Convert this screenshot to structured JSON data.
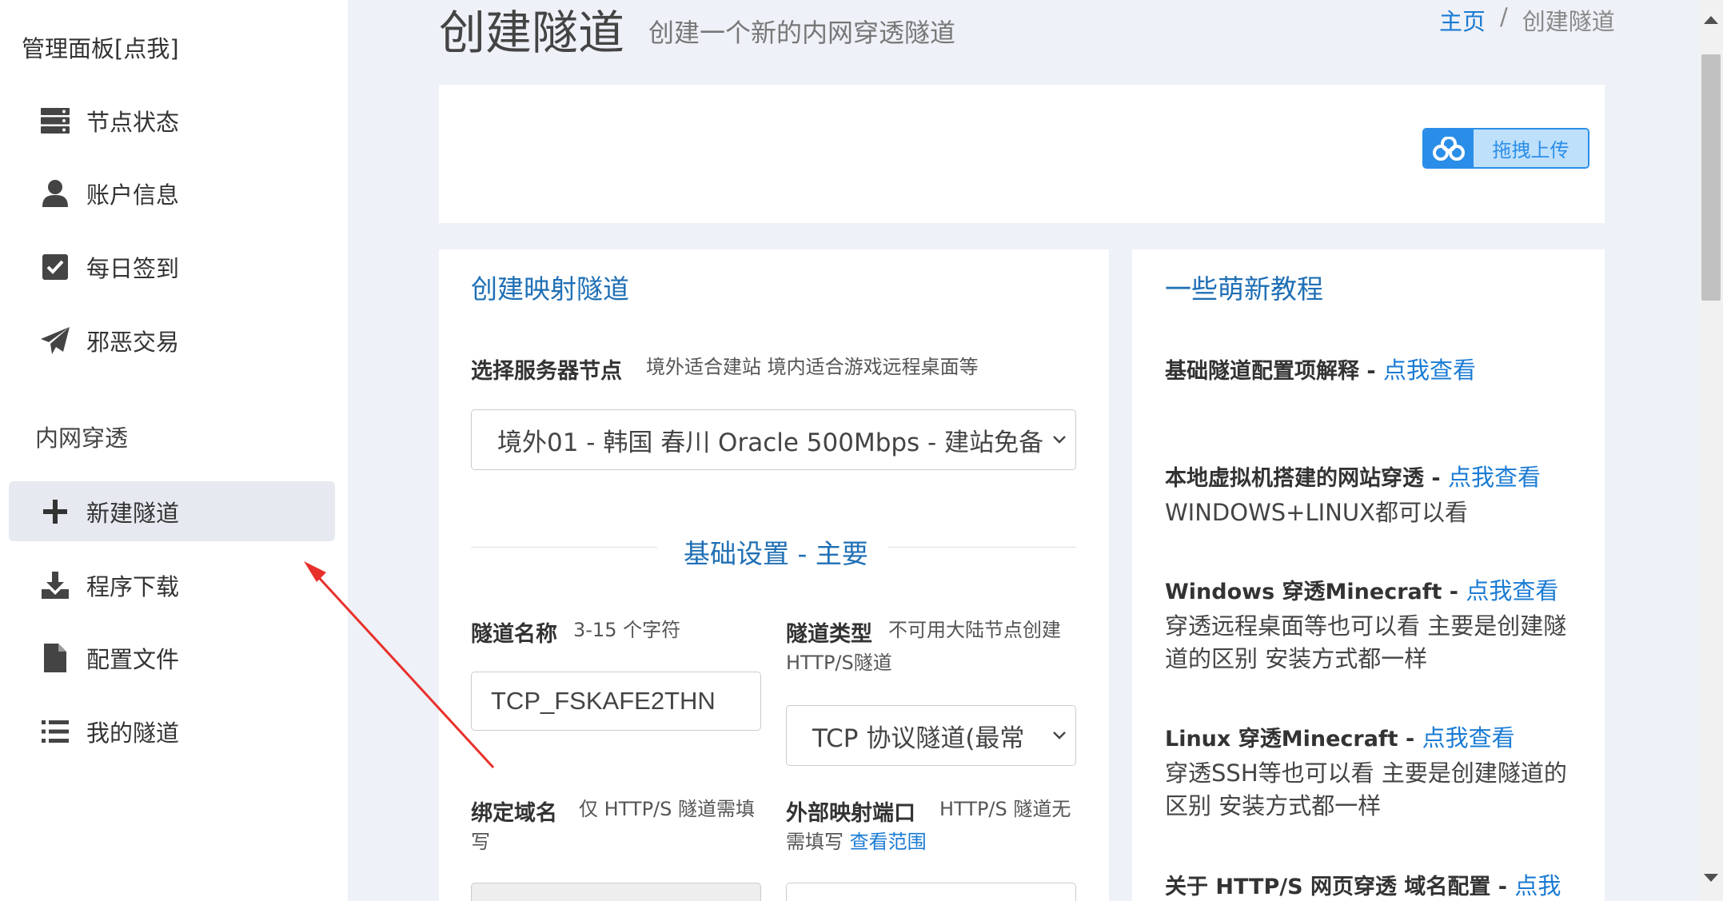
{
  "sidebar": {
    "title": "管理面板[点我]",
    "items": [
      {
        "label": "节点状态",
        "icon": "server-icon"
      },
      {
        "label": "账户信息",
        "icon": "user-icon"
      },
      {
        "label": "每日签到",
        "icon": "check-square-icon"
      },
      {
        "label": "邪恶交易",
        "icon": "paper-plane-icon"
      }
    ],
    "section": "内网穿透",
    "section_items": [
      {
        "label": "新建隧道",
        "icon": "plus-icon",
        "active": true
      },
      {
        "label": "程序下载",
        "icon": "download-icon"
      },
      {
        "label": "配置文件",
        "icon": "file-icon"
      },
      {
        "label": "我的隧道",
        "icon": "list-icon"
      }
    ]
  },
  "header": {
    "title": "创建隧道",
    "subtitle": "创建一个新的内网穿透隧道",
    "breadcrumb": {
      "home": "主页",
      "separator": "/",
      "current": "创建隧道"
    }
  },
  "upload": {
    "label": "拖拽上传",
    "icon": "cloud-icon"
  },
  "form": {
    "heading": "创建映射隧道",
    "node_label": "选择服务器节点",
    "node_hint": "境外适合建站 境内适合游戏远程桌面等",
    "node_value": "境外01 - 韩国 春川 Oracle 500Mbps - 建站免备",
    "section_divider": "基础设置 - 主要",
    "name_label": "隧道名称",
    "name_hint": "3-15 个字符",
    "name_value": "TCP_FSKAFE2THN",
    "type_label": "隧道类型",
    "type_hint": "不可用大陆节点创建HTTP/S隧道",
    "type_value": "TCP 协议隧道(最常",
    "domain_label": "绑定域名",
    "domain_hint": "仅 HTTP/S 隧道需填写",
    "port_label": "外部映射端口",
    "port_hint": "HTTP/S 隧道无需填写",
    "port_link": "查看范围"
  },
  "help": {
    "heading": "一些萌新教程",
    "link_text": "点我查看",
    "items": [
      {
        "title": "基础隧道配置项解释",
        "desc": ""
      },
      {
        "title": "本地虚拟机搭建的网站穿透",
        "desc": "WINDOWS+LINUX都可以看"
      },
      {
        "title": "Windows 穿透Minecraft",
        "desc": "穿透远程桌面等也可以看 主要是创建隧道的区别 安装方式都一样"
      },
      {
        "title": "Linux 穿透Minecraft",
        "desc": "穿透SSH等也可以看 主要是创建隧道的区别 安装方式都一样"
      },
      {
        "title": "关于 HTTP/S 网页穿透 域名配置",
        "link": "点我"
      }
    ]
  },
  "colors": {
    "accent": "#1a7bd4",
    "heading": "#1f6fb5",
    "annotation": "#e8302b"
  }
}
